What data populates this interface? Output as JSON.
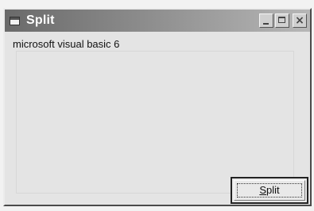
{
  "window": {
    "title": "Split",
    "controls": {
      "minimize_icon": "minimize-icon",
      "maximize_icon": "maximize-icon",
      "close_icon": "close-icon"
    }
  },
  "form": {
    "label_text": "microsoft visual basic 6",
    "button": {
      "accel_char": "S",
      "rest_label": "plit"
    }
  },
  "colors": {
    "titlebar_start": "#6a6a6a",
    "titlebar_end": "#b7b7b7",
    "form_background": "#e4e4e4"
  }
}
